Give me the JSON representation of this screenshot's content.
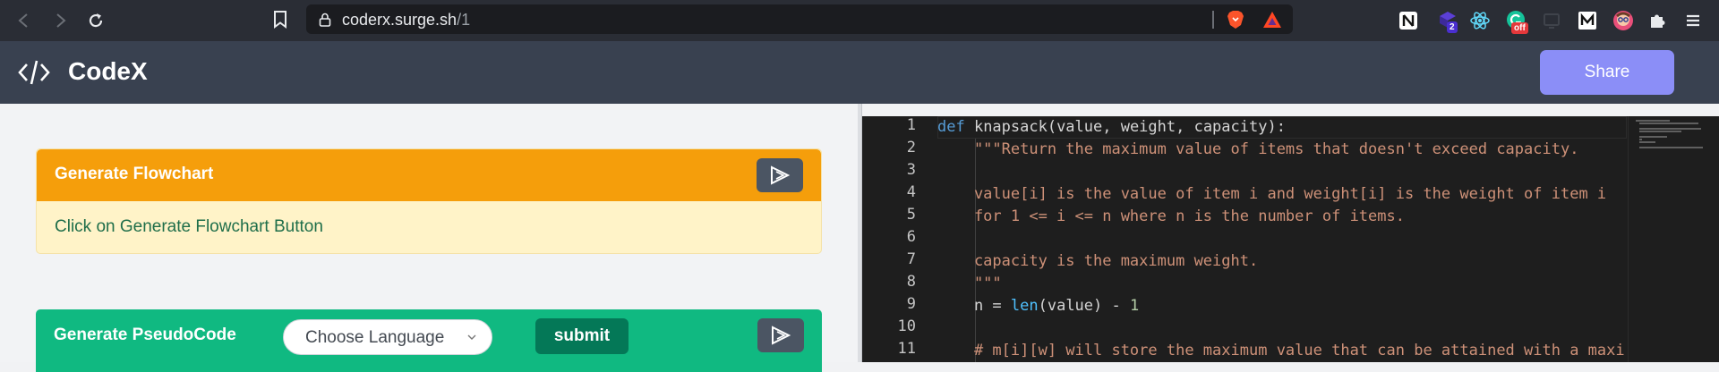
{
  "browser": {
    "url_host": "coderx.surge.sh",
    "url_path": "/1",
    "extensions": [
      {
        "icon": "notion-icon"
      },
      {
        "icon": "extension-purple-icon",
        "badge": "2"
      },
      {
        "icon": "react-devtools-icon"
      },
      {
        "icon": "grammarly-icon",
        "badge": "off"
      },
      {
        "icon": "screen-icon"
      },
      {
        "icon": "medium-icon"
      },
      {
        "icon": "avatar-icon"
      },
      {
        "icon": "puzzle-icon"
      },
      {
        "icon": "menu-icon"
      }
    ]
  },
  "app": {
    "title": "CodeX",
    "share_label": "Share"
  },
  "flowchart": {
    "title": "Generate Flowchart",
    "body": "Click on Generate Flowchart Button"
  },
  "pseudocode": {
    "title": "Generate PseudoCode",
    "language_placeholder": "Choose Language",
    "submit_label": "submit"
  },
  "editor": {
    "line_numbers": [
      "1",
      "2",
      "3",
      "4",
      "5",
      "6",
      "7",
      "8",
      "9",
      "10",
      "11"
    ],
    "lines": [
      "def knapsack(value, weight, capacity):",
      "    \"\"\"Return the maximum value of items that doesn't exceed capacity.",
      "",
      "    value[i] is the value of item i and weight[i] is the weight of item i",
      "    for 1 <= i <= n where n is the number of items.",
      "",
      "    capacity is the maximum weight.",
      "    \"\"\"",
      "    n = len(value) - 1",
      "",
      "    # m[i][w] will store the maximum value that can be attained with a maxi"
    ]
  },
  "colors": {
    "flowchart_header": "#f59e0b",
    "pseudocode_header": "#10b981",
    "share_button": "#8b8ef7",
    "app_header": "#394150"
  }
}
